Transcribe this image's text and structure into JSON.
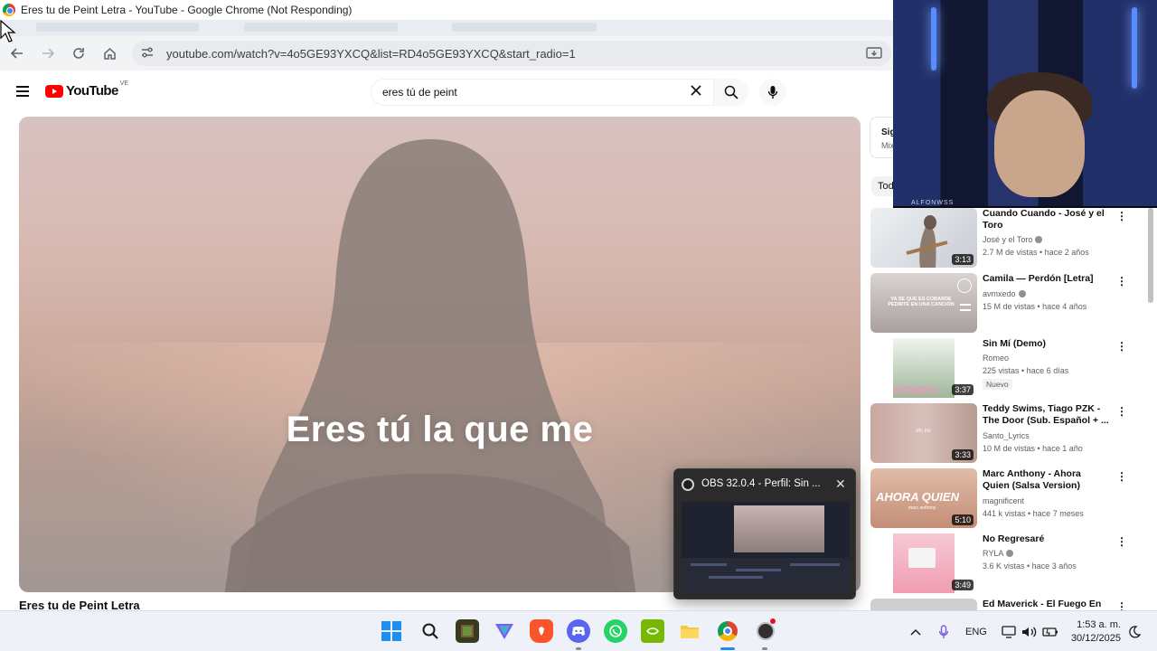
{
  "window": {
    "title": "Eres tu de Peint Letra - YouTube - Google Chrome (Not Responding)"
  },
  "browser": {
    "url": "youtube.com/watch?v=4o5GE93YXCQ&list=RD4o5GE93YXCQ&start_radio=1"
  },
  "youtube": {
    "logo_text": "YouTube",
    "country_code": "VE",
    "search_value": "eres tú de peint",
    "video_caption": "Eres tú la que me",
    "video_title": "Eres tu de Peint Letra",
    "next_label": "Sig",
    "next_sub": "Mix",
    "filter_chip": "Tod",
    "recommendations": [
      {
        "title": "Cuando Cuando - José y el Toro",
        "channel": "José y el Toro",
        "verified": true,
        "meta": "2.7 M de vistas • hace 2 años",
        "duration": "3:13",
        "badge": "",
        "thumb_color": "#d9dde3"
      },
      {
        "title": "Camila — Perdón [Letra]",
        "channel": "avmxedo",
        "verified": true,
        "meta": "15 M de vistas • hace 4 años",
        "duration": "",
        "badge": "",
        "thumb_color": "#cfc9c7"
      },
      {
        "title": "Sin Mí (Demo)",
        "channel": "Romeo",
        "verified": false,
        "meta": "225 vistas • hace 6 días",
        "duration": "3:37",
        "badge": "Nuevo",
        "thumb_color": "#e8eee6"
      },
      {
        "title": "Teddy Swims, Tiago PZK - The Door (Sub. Español + ...",
        "channel": "Santo_Lyrics",
        "verified": false,
        "meta": "10 M de vistas • hace 1 año",
        "duration": "3:33",
        "badge": "",
        "thumb_color": "#cfb7b3"
      },
      {
        "title": "Marc Anthony - Ahora Quien (Salsa Version) (Letra)",
        "channel": "magnificent",
        "verified": false,
        "meta": "441 k vistas • hace 7 meses",
        "duration": "5:10",
        "badge": "",
        "thumb_color": "#d9b3a0"
      },
      {
        "title": "No Regresaré",
        "channel": "RYLA",
        "verified": true,
        "meta": "3.6 K vistas • hace 3 años",
        "duration": "3:49",
        "badge": "",
        "thumb_color": "#f3c3cf"
      },
      {
        "title": "Ed Maverick - El Fuego En El",
        "channel": "",
        "verified": false,
        "meta": "",
        "duration": "",
        "badge": "",
        "thumb_color": "#d0d0d0"
      }
    ]
  },
  "thumb_overlays": {
    "rec2_text": "YA SE QUE ES COBARDE PEDIRTE EN UNA CANCIÓN",
    "rec3_text": "ROMEO",
    "rec4_text": "oh, no",
    "rec5_text": "AHORA QUIEN",
    "rec5_sub": "marc anthony"
  },
  "webcam": {
    "tag": "ALFONWSS"
  },
  "obs": {
    "title": "OBS 32.0.4 - Perfil: Sin ..."
  },
  "taskbar": {
    "language": "ENG",
    "time": "1:53 a. m.",
    "date": "30/12/2025",
    "colors": {
      "accent": "#1f8ef0",
      "youtube_red": "#ff0000"
    }
  }
}
